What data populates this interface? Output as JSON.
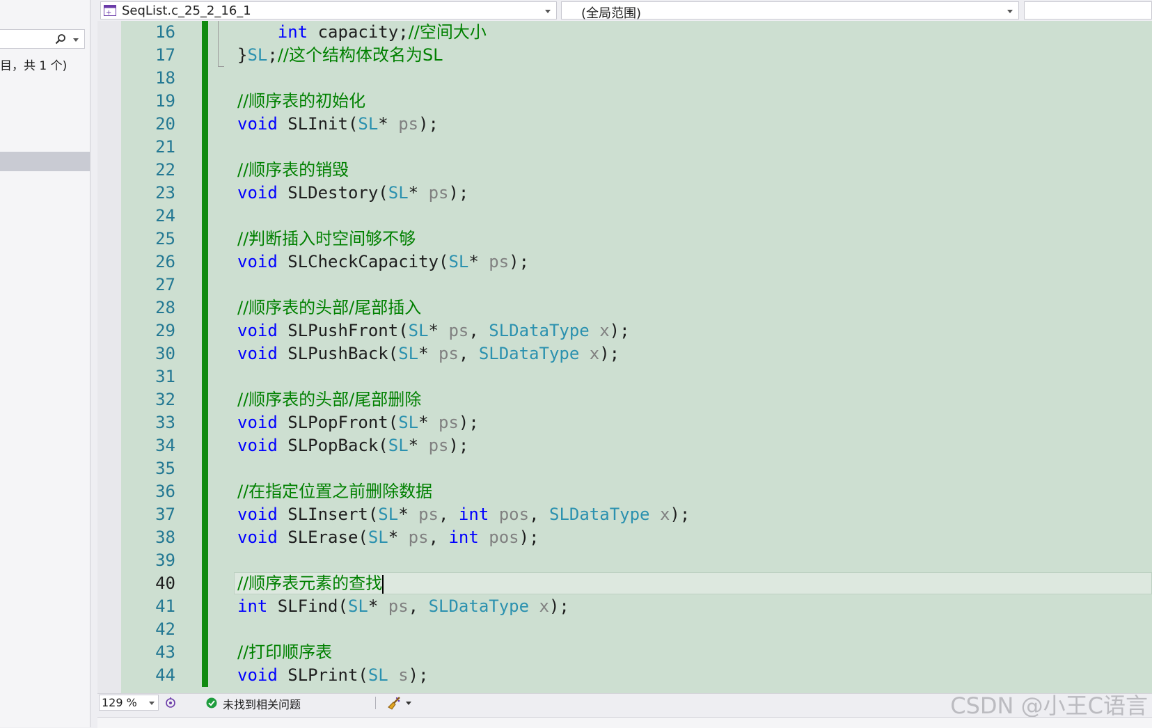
{
  "left_panel": {
    "item_count_text": "目，共 1 个)"
  },
  "nav_bar": {
    "file_name": "SeqList.c_25_2_16_1",
    "scope": "(全局范围)",
    "member": ""
  },
  "editor": {
    "current_line": 40,
    "lines": [
      {
        "n": "16",
        "tokens": [
          {
            "t": "    "
          },
          {
            "t": "int",
            "c": "kw"
          },
          {
            "t": " capacity;"
          },
          {
            "t": "//空间大小",
            "c": "cm"
          }
        ]
      },
      {
        "n": "17",
        "tokens": [
          {
            "t": "}"
          },
          {
            "t": "SL",
            "c": "ty"
          },
          {
            "t": ";"
          },
          {
            "t": "//这个结构体改名为SL",
            "c": "cm"
          }
        ]
      },
      {
        "n": "18",
        "tokens": []
      },
      {
        "n": "19",
        "tokens": [
          {
            "t": "//顺序表的初始化",
            "c": "cm"
          }
        ]
      },
      {
        "n": "20",
        "tokens": [
          {
            "t": "void",
            "c": "kw"
          },
          {
            "t": " SLInit("
          },
          {
            "t": "SL",
            "c": "ty"
          },
          {
            "t": "* "
          },
          {
            "t": "ps",
            "c": "pm"
          },
          {
            "t": ");"
          }
        ]
      },
      {
        "n": "21",
        "tokens": []
      },
      {
        "n": "22",
        "tokens": [
          {
            "t": "//顺序表的销毁",
            "c": "cm"
          }
        ]
      },
      {
        "n": "23",
        "tokens": [
          {
            "t": "void",
            "c": "kw"
          },
          {
            "t": " SLDestory("
          },
          {
            "t": "SL",
            "c": "ty"
          },
          {
            "t": "* "
          },
          {
            "t": "ps",
            "c": "pm"
          },
          {
            "t": ");"
          }
        ]
      },
      {
        "n": "24",
        "tokens": []
      },
      {
        "n": "25",
        "tokens": [
          {
            "t": "//判断插入时空间够不够",
            "c": "cm"
          }
        ]
      },
      {
        "n": "26",
        "tokens": [
          {
            "t": "void",
            "c": "kw"
          },
          {
            "t": " SLCheckCapacity("
          },
          {
            "t": "SL",
            "c": "ty"
          },
          {
            "t": "* "
          },
          {
            "t": "ps",
            "c": "pm"
          },
          {
            "t": ");"
          }
        ]
      },
      {
        "n": "27",
        "tokens": []
      },
      {
        "n": "28",
        "tokens": [
          {
            "t": "//顺序表的头部/尾部插入",
            "c": "cm"
          }
        ]
      },
      {
        "n": "29",
        "tokens": [
          {
            "t": "void",
            "c": "kw"
          },
          {
            "t": " SLPushFront("
          },
          {
            "t": "SL",
            "c": "ty"
          },
          {
            "t": "* "
          },
          {
            "t": "ps",
            "c": "pm"
          },
          {
            "t": ", "
          },
          {
            "t": "SLDataType",
            "c": "ty"
          },
          {
            "t": " "
          },
          {
            "t": "x",
            "c": "pm"
          },
          {
            "t": ");"
          }
        ]
      },
      {
        "n": "30",
        "tokens": [
          {
            "t": "void",
            "c": "kw"
          },
          {
            "t": " SLPushBack("
          },
          {
            "t": "SL",
            "c": "ty"
          },
          {
            "t": "* "
          },
          {
            "t": "ps",
            "c": "pm"
          },
          {
            "t": ", "
          },
          {
            "t": "SLDataType",
            "c": "ty"
          },
          {
            "t": " "
          },
          {
            "t": "x",
            "c": "pm"
          },
          {
            "t": ");"
          }
        ]
      },
      {
        "n": "31",
        "tokens": []
      },
      {
        "n": "32",
        "tokens": [
          {
            "t": "//顺序表的头部/尾部删除",
            "c": "cm"
          }
        ]
      },
      {
        "n": "33",
        "tokens": [
          {
            "t": "void",
            "c": "kw"
          },
          {
            "t": " SLPopFront("
          },
          {
            "t": "SL",
            "c": "ty"
          },
          {
            "t": "* "
          },
          {
            "t": "ps",
            "c": "pm"
          },
          {
            "t": ");"
          }
        ]
      },
      {
        "n": "34",
        "tokens": [
          {
            "t": "void",
            "c": "kw"
          },
          {
            "t": " SLPopBack("
          },
          {
            "t": "SL",
            "c": "ty"
          },
          {
            "t": "* "
          },
          {
            "t": "ps",
            "c": "pm"
          },
          {
            "t": ");"
          }
        ]
      },
      {
        "n": "35",
        "tokens": []
      },
      {
        "n": "36",
        "tokens": [
          {
            "t": "//在指定位置之前删除数据",
            "c": "cm"
          }
        ]
      },
      {
        "n": "37",
        "tokens": [
          {
            "t": "void",
            "c": "kw"
          },
          {
            "t": " SLInsert("
          },
          {
            "t": "SL",
            "c": "ty"
          },
          {
            "t": "* "
          },
          {
            "t": "ps",
            "c": "pm"
          },
          {
            "t": ", "
          },
          {
            "t": "int",
            "c": "kw"
          },
          {
            "t": " "
          },
          {
            "t": "pos",
            "c": "pm"
          },
          {
            "t": ", "
          },
          {
            "t": "SLDataType",
            "c": "ty"
          },
          {
            "t": " "
          },
          {
            "t": "x",
            "c": "pm"
          },
          {
            "t": ");"
          }
        ]
      },
      {
        "n": "38",
        "tokens": [
          {
            "t": "void",
            "c": "kw"
          },
          {
            "t": " SLErase("
          },
          {
            "t": "SL",
            "c": "ty"
          },
          {
            "t": "* "
          },
          {
            "t": "ps",
            "c": "pm"
          },
          {
            "t": ", "
          },
          {
            "t": "int",
            "c": "kw"
          },
          {
            "t": " "
          },
          {
            "t": "pos",
            "c": "pm"
          },
          {
            "t": ");"
          }
        ]
      },
      {
        "n": "39",
        "tokens": []
      },
      {
        "n": "40",
        "tokens": [
          {
            "t": "//顺序表元素的查找",
            "c": "cm"
          }
        ]
      },
      {
        "n": "41",
        "tokens": [
          {
            "t": "int",
            "c": "kw"
          },
          {
            "t": " SLFind("
          },
          {
            "t": "SL",
            "c": "ty"
          },
          {
            "t": "* "
          },
          {
            "t": "ps",
            "c": "pm"
          },
          {
            "t": ", "
          },
          {
            "t": "SLDataType",
            "c": "ty"
          },
          {
            "t": " "
          },
          {
            "t": "x",
            "c": "pm"
          },
          {
            "t": ");"
          }
        ]
      },
      {
        "n": "42",
        "tokens": []
      },
      {
        "n": "43",
        "tokens": [
          {
            "t": "//打印顺序表",
            "c": "cm"
          }
        ]
      },
      {
        "n": "44",
        "tokens": [
          {
            "t": "void",
            "c": "kw"
          },
          {
            "t": " SLPrint("
          },
          {
            "t": "SL",
            "c": "ty"
          },
          {
            "t": " "
          },
          {
            "t": "s",
            "c": "pm"
          },
          {
            "t": ");"
          }
        ]
      }
    ]
  },
  "status_bar": {
    "zoom": "129 %",
    "issues_text": "未找到相关问题"
  },
  "watermark": "CSDN @小王C语言",
  "colors": {
    "editor_bg": "#cddfd1",
    "keyword": "#0000ff",
    "type": "#2b91af",
    "comment": "#008000",
    "param": "#808080",
    "change_bar": "#108a10"
  }
}
